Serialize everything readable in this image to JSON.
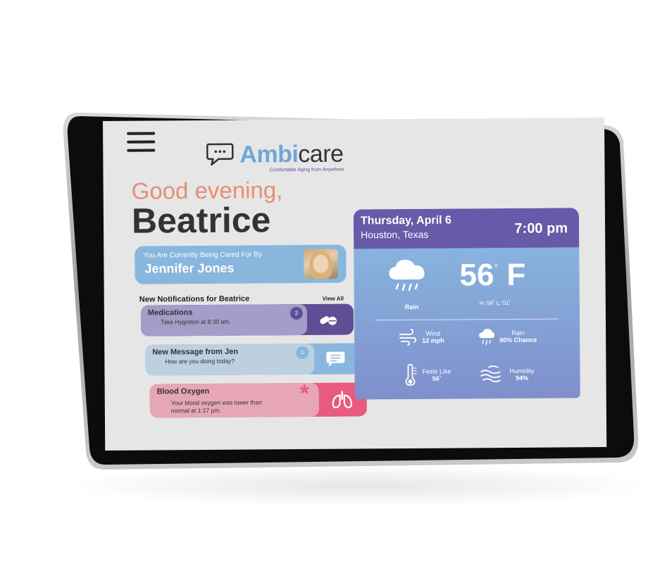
{
  "app": {
    "brand_part1": "Ambi",
    "brand_part2": "care",
    "tagline": "Comfortable Aging from Anywhere"
  },
  "greeting": {
    "line1": "Good evening,",
    "name": "Beatrice"
  },
  "caregiver": {
    "label": "You Are Currently Being Cared For By",
    "name": "Jennifer Jones"
  },
  "notifications": {
    "title": "New Notifications for Beatrice",
    "view_all": "View All",
    "items": [
      {
        "title": "Medications",
        "subtitle": "Take Hygroton at 8:30 am.",
        "badge": "2",
        "icon": "pills-icon",
        "color": "#5e4e96"
      },
      {
        "title": "New Message from Jen",
        "subtitle": "How are you doing today?",
        "badge": "1",
        "icon": "message-icon",
        "color": "#89b6dd"
      },
      {
        "title": "Blood Oxygen",
        "subtitle_line1": "Your blood oxygen was lower than",
        "subtitle_line2": "normal at 1:17 pm.",
        "badge": "*",
        "icon": "lungs-icon",
        "color": "#e85a7e"
      }
    ]
  },
  "weather": {
    "date": "Thursday, April 6",
    "location": "Houston, Texas",
    "time": "7:00 pm",
    "temp": "56",
    "temp_unit": "F",
    "degree": "°",
    "condition": "Rain",
    "hi_lo": "H: 58˚ L: 51˚",
    "wind_label": "Wind",
    "wind_value": "12 mph",
    "rain_label": "Rain",
    "rain_value": "90% Chance",
    "feels_label": "Feels Like",
    "feels_value": "56˚",
    "humidity_label": "Humidity",
    "humidity_value": "94%"
  },
  "colors": {
    "accent_purple": "#675aa8",
    "accent_blue": "#89b6dd",
    "accent_pink": "#e85a7e",
    "greeting_orange": "#e58f73"
  }
}
